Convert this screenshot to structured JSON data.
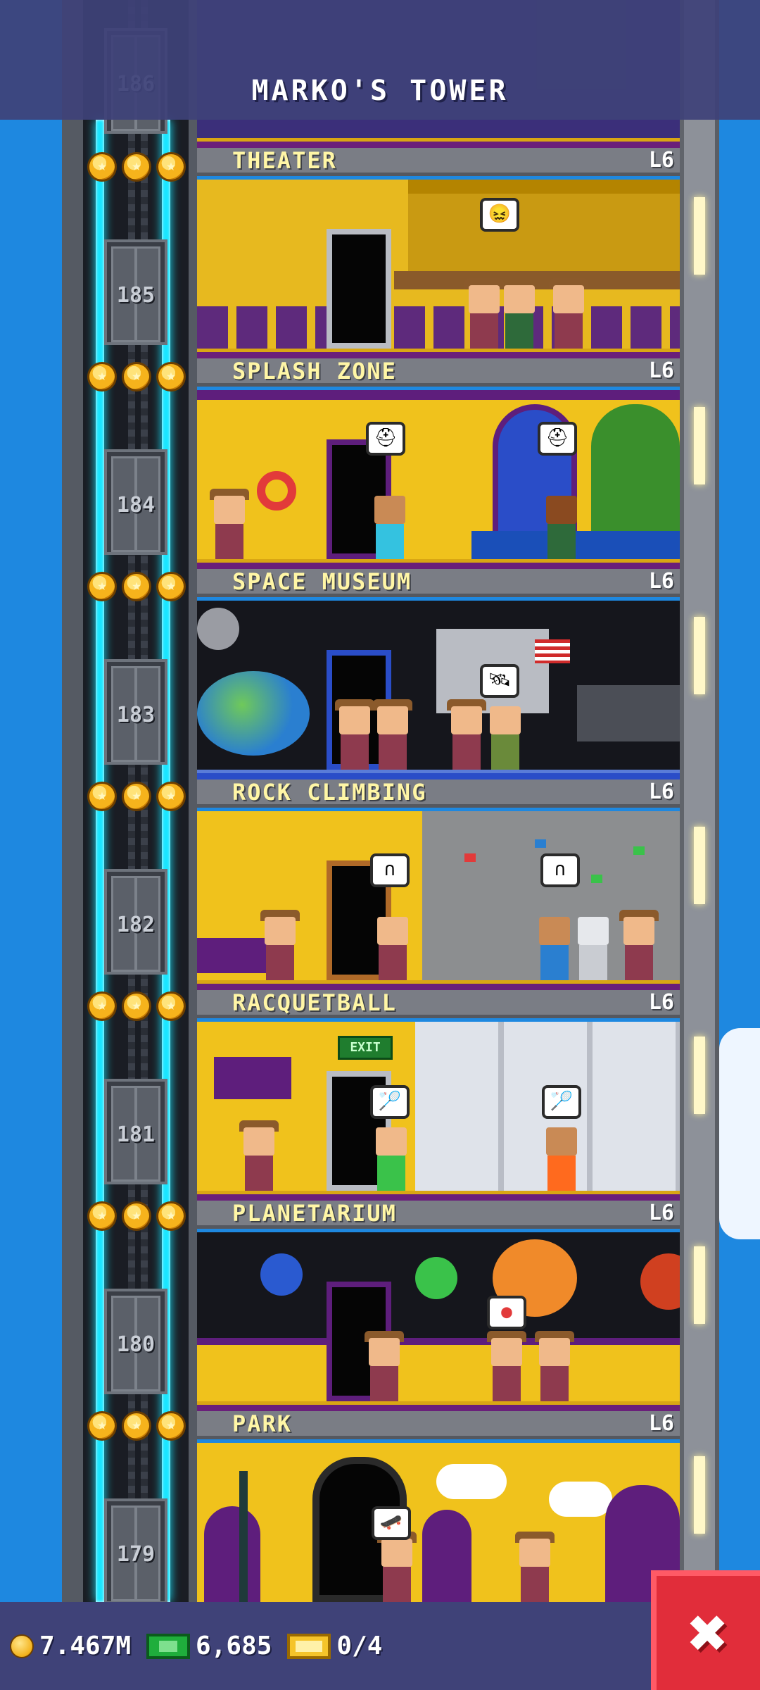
{
  "header": {
    "title": "MARKO'S TOWER"
  },
  "floors": [
    {
      "number": "186",
      "name": "",
      "level": ""
    },
    {
      "number": "185",
      "name": "THEATER",
      "level": "L6",
      "bubbles": [
        "😖"
      ]
    },
    {
      "number": "184",
      "name": "SPLASH ZONE",
      "level": "L6",
      "bubbles": [
        "⛑",
        "⛑"
      ]
    },
    {
      "number": "183",
      "name": "SPACE MUSEUM",
      "level": "L6",
      "bubbles": [
        "🛰"
      ]
    },
    {
      "number": "182",
      "name": "ROCK CLIMBING",
      "level": "L6",
      "bubbles": [
        "∩",
        "∩"
      ]
    },
    {
      "number": "181",
      "name": "RACQUETBALL",
      "level": "L6",
      "bubbles": [
        "🏸",
        "🏸"
      ],
      "exit_sign": "EXIT"
    },
    {
      "number": "180",
      "name": "PLANETARIUM",
      "level": "L6",
      "bubbles": [
        "●"
      ]
    },
    {
      "number": "179",
      "name": "PARK",
      "level": "L6",
      "bubbles": [
        "🛹"
      ]
    }
  ],
  "status": {
    "coins": "7.467M",
    "bux": "6,685",
    "tickets": "0/4"
  },
  "close": {
    "label": "✖"
  },
  "icons": {
    "coin": "coin-icon",
    "bux": "bux-icon",
    "ticket": "ticket-icon",
    "star": "star-icon",
    "close": "close-icon"
  },
  "colors": {
    "sky": "#1e88e0",
    "bar": "#3f4278",
    "neon": "#19e6ff",
    "floor_label": "#fff6a6",
    "close_button": "#e12d3a"
  }
}
